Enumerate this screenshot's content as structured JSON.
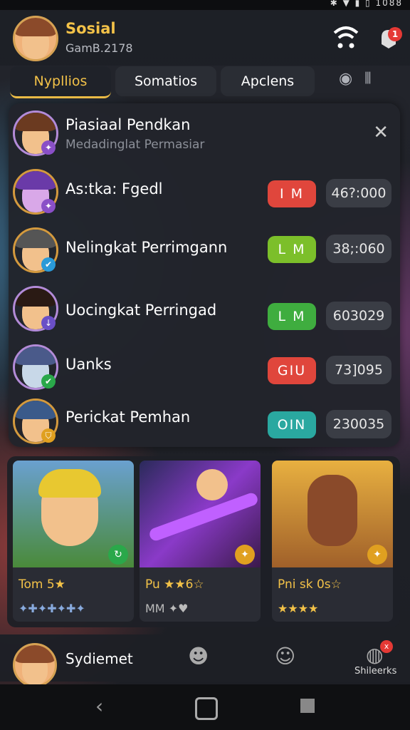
{
  "status_bar": {
    "icons_text": "✱ ▼ ▮ ▯ 1088"
  },
  "header": {
    "title": "Sosial",
    "subtitle": "GamB.2178",
    "notification_count": "1"
  },
  "tabs": [
    {
      "label": "Nypllios",
      "active": true
    },
    {
      "label": "Somatios",
      "active": false
    },
    {
      "label": "Apclens",
      "active": false
    }
  ],
  "panel": {
    "title": "Piasiaal Pendkan",
    "subtitle": "Medadinglat Permasiar",
    "rows": [
      {
        "name": "As:tka: Fgedl",
        "badge": "I M",
        "badge_color": "#e0463c",
        "score": "46?:000"
      },
      {
        "name": "Nelingkat Perrimgann",
        "badge": "L M",
        "badge_color": "#7cbf2a",
        "score": "38;:060"
      },
      {
        "name": "Uocingkat Perringad",
        "badge": "L M",
        "badge_color": "#3fad3f",
        "score": "603029"
      },
      {
        "name": "Uanks",
        "badge": "GIU",
        "badge_color": "#e0463c",
        "score": "73]095"
      },
      {
        "name": "Perickat Pemhan",
        "badge": "OIN",
        "badge_color": "#2aa8a0",
        "score": "230035"
      }
    ]
  },
  "cards": [
    {
      "title": "Tom 5★",
      "extra": "✦✚✦✚✦✚✦"
    },
    {
      "title": "Pu ★★6☆",
      "extra": "MM ✦♥"
    },
    {
      "title": "Pni sk 0s☆",
      "extra": "★★★★"
    }
  ],
  "bottom_bar": {
    "profile_label": "Sydiemet",
    "third_label": "Shileerks",
    "third_badge": "x"
  },
  "colors": {
    "accent": "#f3c248",
    "background": "#1a1c22"
  }
}
